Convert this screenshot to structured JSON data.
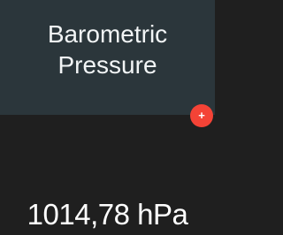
{
  "widget": {
    "title_line1": "Barometric",
    "title_line2": "Pressure",
    "value": "1014,78 hPa",
    "add_button_label": "+"
  },
  "colors": {
    "header_background": "#2b363b",
    "body_background": "#1f1f1f",
    "accent": "#f44336",
    "text": "#ffffff"
  },
  "icons": {
    "add": "plus-icon"
  }
}
